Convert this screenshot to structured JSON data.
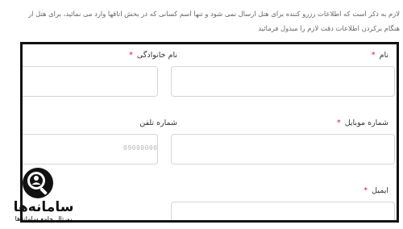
{
  "notice": {
    "line1": "لازم به ذکر است که اطلاعات رزرو کننده برای هتل ارسال نمی شود و تنها اسم کسانی که در بخش اتاقها وارد می نمائید، برای هتل ار",
    "line2": "هنگام برکردن اطلاعات دقت لازم را مبذول فرمائید"
  },
  "form": {
    "first_name": {
      "label": "نام",
      "required_mark": "*",
      "value": ""
    },
    "last_name": {
      "label": "نام خانوادگی",
      "required_mark": "*",
      "value": ""
    },
    "mobile": {
      "label": "شماره موبایل",
      "required_mark": "*",
      "value": ""
    },
    "phone": {
      "label": "شماره تلفن",
      "placeholder": "09000000",
      "value": ""
    },
    "email": {
      "label": "ایمیل",
      "required_mark": "*",
      "value": ""
    }
  },
  "watermark": {
    "title": "سامانه‌ها",
    "subtitle": "پورتال جامع سامانه‌ها",
    "icon": "search-person-icon"
  }
}
